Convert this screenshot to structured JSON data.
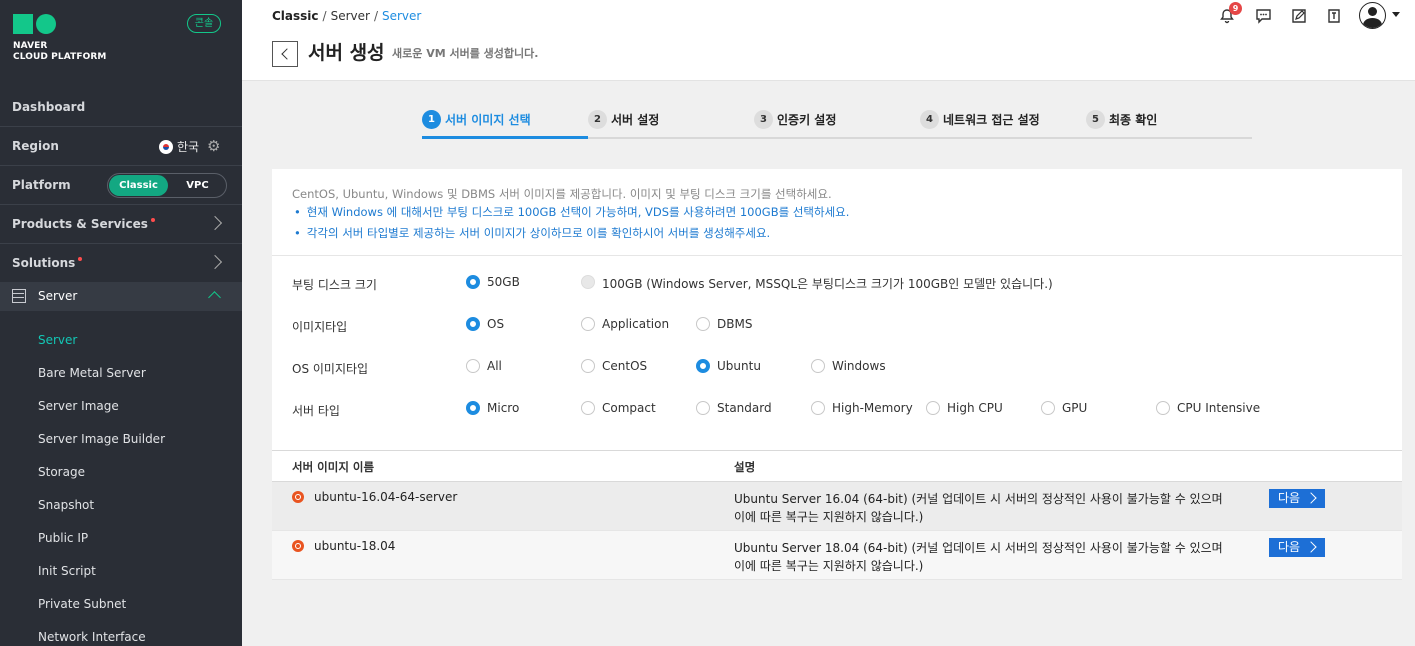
{
  "sidebar": {
    "logo_line1": "NAVER",
    "logo_line2": "CLOUD PLATFORM",
    "console_badge": "콘솔",
    "dashboard": "Dashboard",
    "region_label": "Region",
    "region_value": "한국",
    "platform_label": "Platform",
    "platform_options": [
      "Classic",
      "VPC"
    ],
    "platform_selected": "Classic",
    "products_label": "Products & Services",
    "solutions_label": "Solutions",
    "server_group": "Server",
    "server_items": [
      "Server",
      "Bare Metal Server",
      "Server Image",
      "Server Image Builder",
      "Storage",
      "Snapshot",
      "Public IP",
      "Init Script",
      "Private Subnet",
      "Network Interface"
    ],
    "active_item": "Server"
  },
  "header": {
    "breadcrumb": [
      "Classic",
      "Server",
      "Server"
    ],
    "title": "서버 생성",
    "subtitle": "새로운 VM 서버를 생성합니다.",
    "notification_count": "9",
    "icons": [
      "bell-icon",
      "chat-icon",
      "edit-note-icon",
      "guide-book-icon",
      "user-avatar-icon"
    ]
  },
  "steps": [
    {
      "num": "1",
      "label": "서버 이미지 선택",
      "active": true
    },
    {
      "num": "2",
      "label": "서버 설정",
      "active": false
    },
    {
      "num": "3",
      "label": "인증키 설정",
      "active": false
    },
    {
      "num": "4",
      "label": "네트워크 접근 설정",
      "active": false
    },
    {
      "num": "5",
      "label": "최종 확인",
      "active": false
    }
  ],
  "notice": {
    "intro": "CentOS, Ubuntu, Windows 및 DBMS 서버 이미지를 제공합니다. 이미지 및 부팅 디스크 크기를 선택하세요.",
    "bullets": [
      "현재 Windows 에 대해서만 부팅 디스크로 100GB 선택이 가능하며, VDS를 사용하려면 100GB를 선택하세요.",
      "각각의 서버 타입별로 제공하는 서버 이미지가 상이하므로 이를 확인하시어 서버를 생성해주세요."
    ]
  },
  "options": {
    "boot_disk": {
      "label": "부팅 디스크 크기",
      "choices": [
        "50GB",
        "100GB (Windows Server, MSSQL은 부팅디스크 크기가 100GB인 모델만 있습니다.)"
      ],
      "selected": "50GB"
    },
    "image_type": {
      "label": "이미지타입",
      "choices": [
        "OS",
        "Application",
        "DBMS"
      ],
      "selected": "OS"
    },
    "os_image_type": {
      "label": "OS 이미지타입",
      "choices": [
        "All",
        "CentOS",
        "Ubuntu",
        "Windows"
      ],
      "selected": "Ubuntu"
    },
    "server_type": {
      "label": "서버 타입",
      "choices": [
        "Micro",
        "Compact",
        "Standard",
        "High-Memory",
        "High CPU",
        "GPU",
        "CPU Intensive"
      ],
      "selected": "Micro"
    }
  },
  "table": {
    "columns": [
      "서버 이미지 이름",
      "설명"
    ],
    "rows": [
      {
        "name": "ubuntu-16.04-64-server",
        "desc_line1": "Ubuntu Server 16.04 (64-bit) (커널 업데이트 시 서버의 정상적인 사용이 불가능할 수 있으며",
        "desc_line2": "이에 따른 복구는 지원하지 않습니다.)",
        "button": "다음"
      },
      {
        "name": "ubuntu-18.04",
        "desc_line1": "Ubuntu Server 18.04 (64-bit) (커널 업데이트 시 서버의 정상적인 사용이 불가능할 수 있으며",
        "desc_line2": "이에 따른 복구는 지원하지 않습니다.)",
        "button": "다음"
      }
    ]
  },
  "colors": {
    "accent": "#1d8ce0",
    "brand_green": "#13c78a",
    "sidebar_bg": "#2a2e36"
  }
}
